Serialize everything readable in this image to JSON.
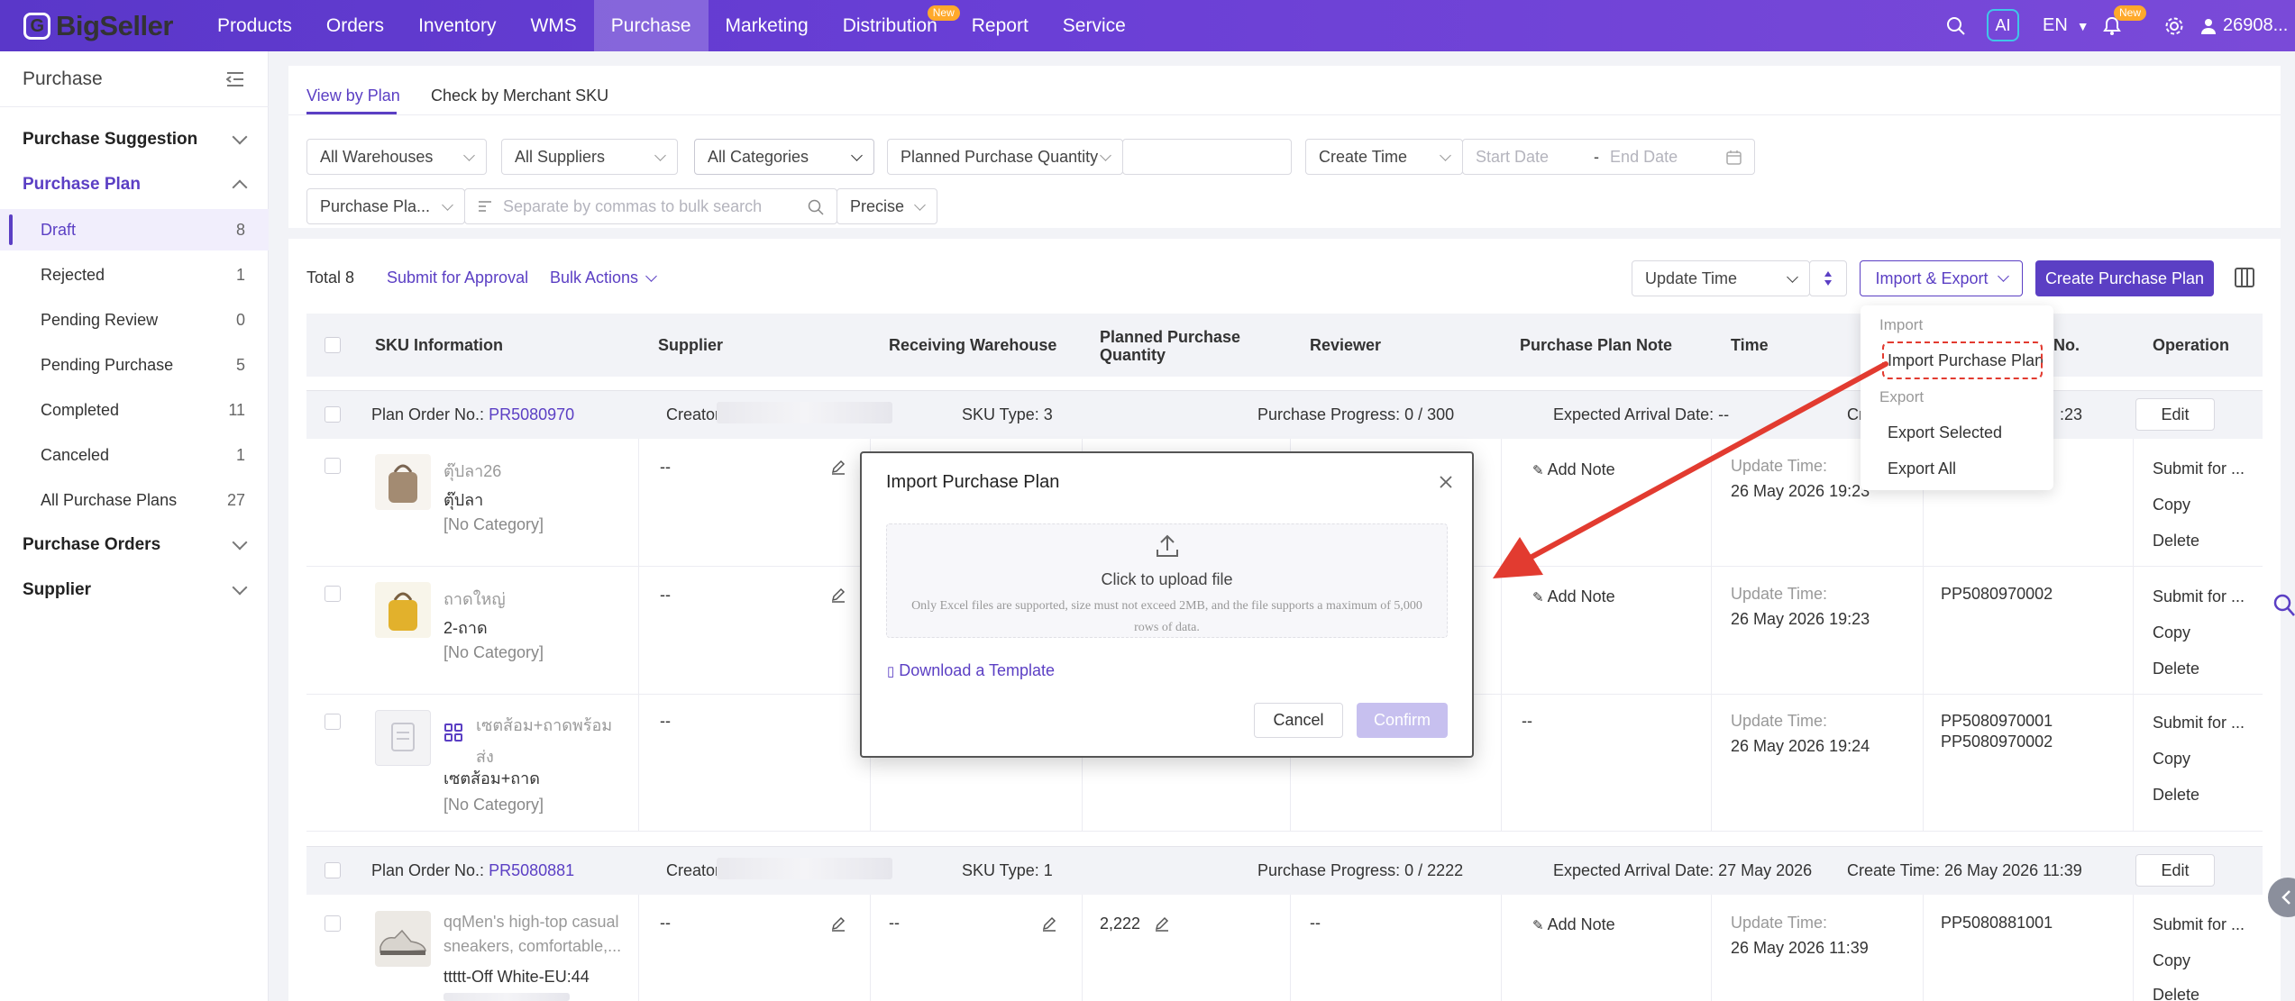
{
  "brand": {
    "name": "BigSeller"
  },
  "nav": {
    "items": [
      "Products",
      "Orders",
      "Inventory",
      "WMS",
      "Purchase",
      "Marketing",
      "Distribution",
      "Report",
      "Service"
    ],
    "new_badge": "New",
    "ai_label": "AI",
    "language": "EN",
    "bell_badge": "New",
    "user": "26908..."
  },
  "sidebar": {
    "title": "Purchase",
    "groups": [
      "Purchase Suggestion",
      "Purchase Plan",
      "Purchase Orders",
      "Supplier"
    ],
    "plan_items": [
      {
        "label": "Draft",
        "count": "8"
      },
      {
        "label": "Rejected",
        "count": "1"
      },
      {
        "label": "Pending Review",
        "count": "0"
      },
      {
        "label": "Pending Purchase",
        "count": "5"
      },
      {
        "label": "Completed",
        "count": "11"
      },
      {
        "label": "Canceled",
        "count": "1"
      },
      {
        "label": "All Purchase Plans",
        "count": "27"
      }
    ]
  },
  "tabs": [
    "View by Plan",
    "Check by Merchant SKU"
  ],
  "filters": {
    "warehouses": "All Warehouses",
    "suppliers": "All Suppliers",
    "categories": "All Categories",
    "quantity": "Planned Purchase Quantity",
    "time_type": "Create Time",
    "start_date": "Start Date",
    "date_sep": "-",
    "end_date": "End Date",
    "search_field": "Purchase Pla...",
    "search_placeholder": "Separate by commas to bulk search",
    "match": "Precise"
  },
  "toolbar": {
    "total": "Total 8",
    "submit": "Submit for Approval",
    "bulk": "Bulk Actions",
    "sort": "Update Time",
    "import_export": "Import & Export",
    "create": "Create Purchase Plan"
  },
  "table_headers": {
    "sku": "SKU Information",
    "supplier": "Supplier",
    "warehouse": "Receiving Warehouse",
    "qty1": "Planned Purchase",
    "qty2": "Quantity",
    "reviewer": "Reviewer",
    "note": "Purchase Plan Note",
    "time": "Time",
    "no": "No.",
    "operation": "Operation"
  },
  "plan1": {
    "order_label": "Plan Order No.:",
    "order_no": "PR5080970",
    "creator": "Creator",
    "sku_type": "SKU Type: 3",
    "progress": "Purchase Progress: 0 / 300",
    "arrival": "Expected Arrival Date: --",
    "create_fragment": "Cr",
    "time_fragment": ":23",
    "edit": "Edit"
  },
  "plan2": {
    "order_label": "Plan Order No.:",
    "order_no": "PR5080881",
    "creator": "Creator",
    "sku_type": "SKU Type: 1",
    "progress": "Purchase Progress: 0 / 2222",
    "arrival": "Expected Arrival Date: 27 May 2026",
    "create_time": "Create Time: 26 May 2026 11:39",
    "edit": "Edit"
  },
  "rows": [
    {
      "name": "ตุ๊ปลา26",
      "variant": "ตุ๊ปลา",
      "category": "[No Category]",
      "supplier": "--",
      "note": "Add Note",
      "time_label": "Update Time:",
      "time": "26 May 2026 19:23",
      "no": "",
      "ops": [
        "Submit for ...",
        "Copy",
        "Delete"
      ]
    },
    {
      "name": "ถาดใหญ่",
      "variant": "2-ถาด",
      "category": "[No Category]",
      "supplier": "--",
      "note": "Add Note",
      "time_label": "Update Time:",
      "time": "26 May 2026 19:23",
      "no": "PP5080970002",
      "ops": [
        "Submit for ...",
        "Copy",
        "Delete"
      ]
    },
    {
      "name_line1": "เซตส้อม+ถาดพร้อม",
      "name_line2": "ส่ง",
      "variant": "เซตส้อม+ถาด",
      "category": "[No Category]",
      "supplier": "--",
      "note": "--",
      "time_label": "Update Time:",
      "time": "26 May 2026 19:24",
      "no1": "PP5080970001",
      "no2": "PP5080970002",
      "ops": [
        "Submit for ...",
        "Copy",
        "Delete"
      ]
    },
    {
      "name_line1": "qqMen's high-top casual",
      "name_line2": "sneakers, comfortable,...",
      "variant": "ttttt-Off White-EU:44",
      "supplier": "--",
      "warehouse": "--",
      "qty": "2,222",
      "reviewer": "--",
      "note": "Add Note",
      "time_label": "Update Time:",
      "time": "26 May 2026 11:39",
      "no": "PP5080881001",
      "ops": [
        "Submit for ...",
        "Copy",
        "Delete"
      ]
    }
  ],
  "dropdown": {
    "import_header": "Import",
    "import_plan": "Import Purchase Plan",
    "export_header": "Export",
    "export_selected": "Export Selected",
    "export_all": "Export All"
  },
  "modal": {
    "title": "Import Purchase Plan",
    "upload_text": "Click to upload file",
    "hint_line1": "Only Excel files are supported, size must not exceed 2MB, and the file supports a maximum of 5,000",
    "hint_line2": "rows of data.",
    "template": "Download a Template",
    "cancel": "Cancel",
    "confirm": "Confirm"
  },
  "colors": {
    "accent": "#5b3fc4",
    "nav": "#6a3fd6",
    "annotation": "#e23b30",
    "badge": "#ffa92b"
  }
}
